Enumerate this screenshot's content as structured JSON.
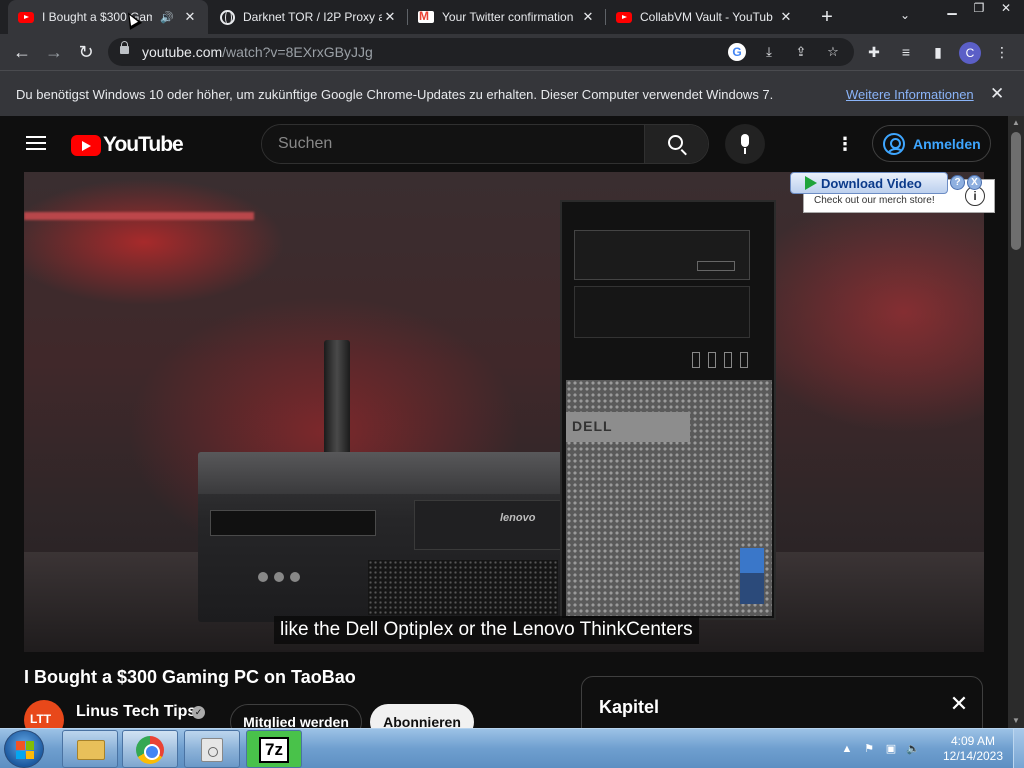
{
  "tabs": [
    {
      "title": "I Bought a $300 Gam",
      "favicon": "youtube-icon",
      "active": true,
      "audio": true
    },
    {
      "title": "Darknet TOR / I2P Proxy a",
      "favicon": "globe-icon",
      "active": false
    },
    {
      "title": "Your Twitter confirmation",
      "favicon": "gmail-icon",
      "active": false
    },
    {
      "title": "CollabVM Vault - YouTub",
      "favicon": "youtube-icon",
      "active": false
    }
  ],
  "tab_close_glyph": "✕",
  "address": {
    "host": "youtube.com",
    "path": "/watch?v=8EXrxGByJJg"
  },
  "profile_initial": "C",
  "infobar": {
    "message": "Du benötigst Windows 10 oder höher, um zukünftige Google Chrome-Updates zu erhalten. Dieser Computer verwendet Windows 7.",
    "link": "Weitere Informationen"
  },
  "youtube": {
    "logo_text": "YouTube",
    "search_placeholder": "Suchen",
    "signin_label": "Anmelden",
    "caption": "like the Dell Optiplex or the Lenovo ThinkCenters",
    "video_title": "I Bought a $300 Gaming PC on TaoBao",
    "channel_name": "Linus Tech Tips",
    "member_button": "Mitglied werden",
    "subscribe_button": "Abonnieren",
    "chapters_title": "Kapitel",
    "video_brand_lenovo": "lenovo",
    "video_brand_dell": "DELL"
  },
  "download_overlay": {
    "button_label": "Download Video",
    "help": "?",
    "close": "X",
    "card_text": "Check out our merch store!",
    "info": "i"
  },
  "taskbar": {
    "time": "4:09 AM",
    "date": "12/14/2023",
    "apps": [
      "explorer-icon",
      "chrome-icon",
      "disk-icon",
      "7zip-icon"
    ],
    "sevenzip_label": "7z"
  },
  "colors": {
    "youtube_red": "#ff0000",
    "link_blue": "#3ea6ff",
    "chrome_dark": "#202124"
  }
}
